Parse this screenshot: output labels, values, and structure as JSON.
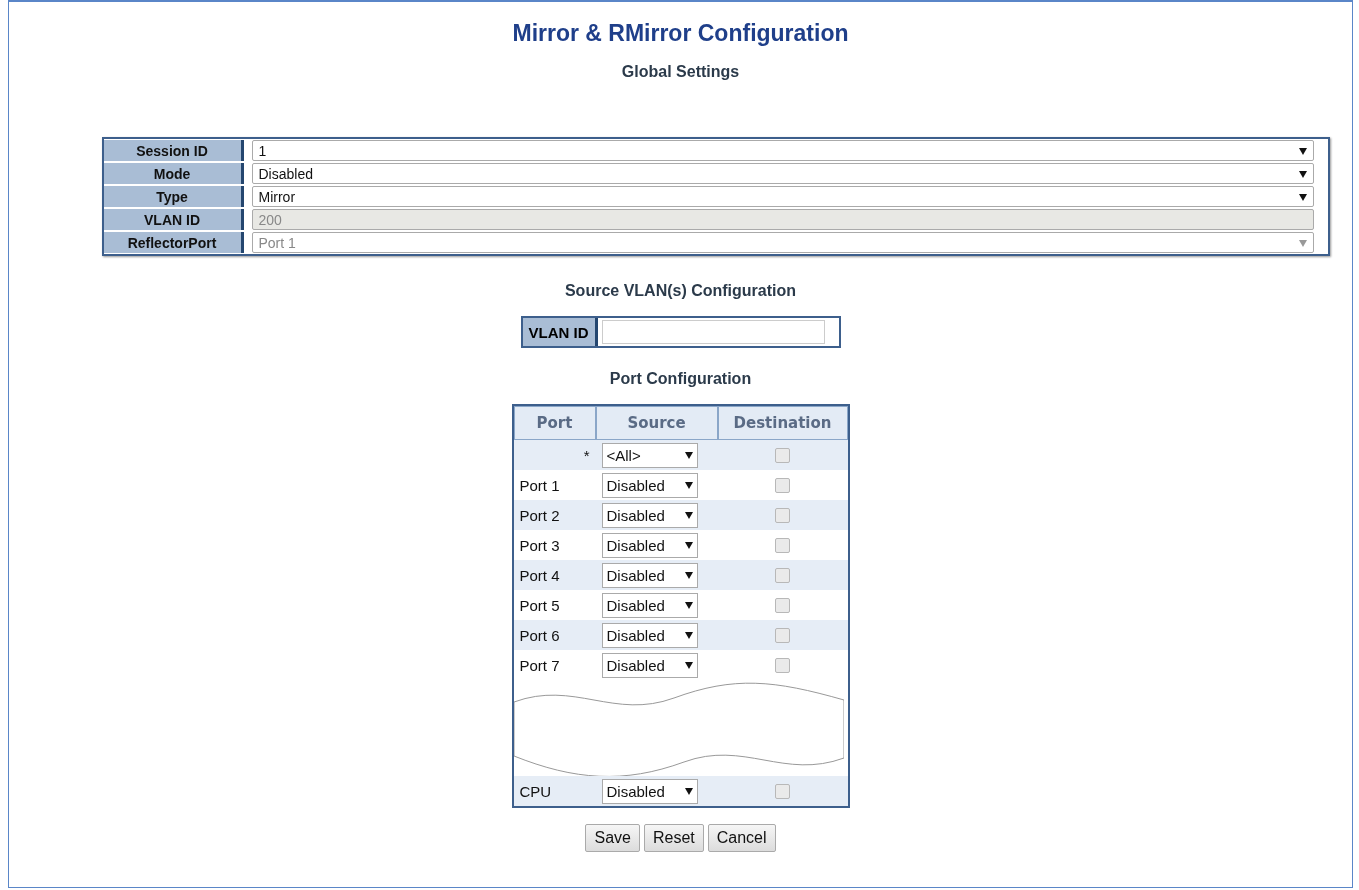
{
  "title": "Mirror & RMirror Configuration",
  "global_settings": {
    "heading": "Global Settings",
    "rows": [
      {
        "label": "Session ID",
        "kind": "select",
        "value": "1",
        "disabled": false
      },
      {
        "label": "Mode",
        "kind": "select",
        "value": "Disabled",
        "disabled": false
      },
      {
        "label": "Type",
        "kind": "select",
        "value": "Mirror",
        "disabled": false
      },
      {
        "label": "VLAN ID",
        "kind": "input",
        "value": "200",
        "disabled": true
      },
      {
        "label": "ReflectorPort",
        "kind": "select",
        "value": "Port 1",
        "disabled": true
      }
    ]
  },
  "source_vlans": {
    "heading": "Source VLAN(s) Configuration",
    "label": "VLAN ID"
  },
  "port_configuration": {
    "heading": "Port Configuration",
    "columns": [
      "Port",
      "Source",
      "Destination"
    ],
    "rows": [
      {
        "port": "*",
        "source": "<All>",
        "checked": false
      },
      {
        "port": "Port 1",
        "source": "Disabled",
        "checked": false
      },
      {
        "port": "Port 2",
        "source": "Disabled",
        "checked": false
      },
      {
        "port": "Port 3",
        "source": "Disabled",
        "checked": false
      },
      {
        "port": "Port 4",
        "source": "Disabled",
        "checked": false
      },
      {
        "port": "Port 5",
        "source": "Disabled",
        "checked": false
      },
      {
        "port": "Port 6",
        "source": "Disabled",
        "checked": false
      },
      {
        "port": "Port 7",
        "source": "Disabled",
        "checked": false
      },
      {
        "kind": "break"
      },
      {
        "port": "CPU",
        "source": "Disabled",
        "checked": false
      }
    ]
  },
  "buttons": [
    "Save",
    "Reset",
    "Cancel"
  ]
}
